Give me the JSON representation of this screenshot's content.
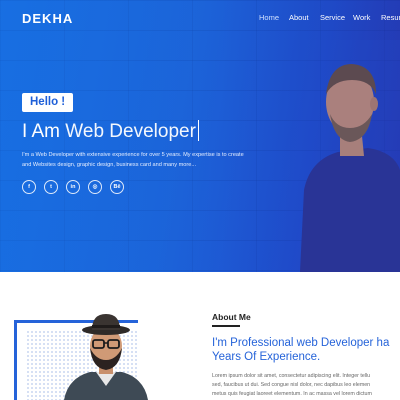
{
  "nav": {
    "brand": "DEKHA",
    "links": [
      "Home",
      "About",
      "Service",
      "Work",
      "Resum"
    ]
  },
  "hero": {
    "hello": "Hello !",
    "title_bold": "I Am",
    "title_light": "Web Developer",
    "description_line1": "I'm a Web Developer with extensive experience for over 5 years. My expertise is to create",
    "description_line2": "and Websites design, graphic design, business card and many more...",
    "socials": [
      {
        "icon": "facebook-icon",
        "glyph": "f"
      },
      {
        "icon": "twitter-icon",
        "glyph": "t"
      },
      {
        "icon": "linkedin-icon",
        "glyph": "in"
      },
      {
        "icon": "dribbble-icon",
        "glyph": "◎"
      },
      {
        "icon": "behance-icon",
        "glyph": "Bē"
      }
    ]
  },
  "about": {
    "heading": "About Me",
    "title_line1": "I'm Professional web Developer ha",
    "title_line2": "Years Of Experience.",
    "text_line1": "Lorem ipsum dolor sit amet, consectetur adipiscing elit. Integer tellu",
    "text_line2": "sed, faucibus ut dui. Sed congue nisl dolor, nec dapibus leo elemen",
    "text_line3": "metus quis feugiat laoreet elementum. In ac massa vel lorem dictum"
  },
  "colors": {
    "accent": "#2563d9",
    "hero_start": "#1a6fe0",
    "hero_end": "#2a3bb8"
  }
}
